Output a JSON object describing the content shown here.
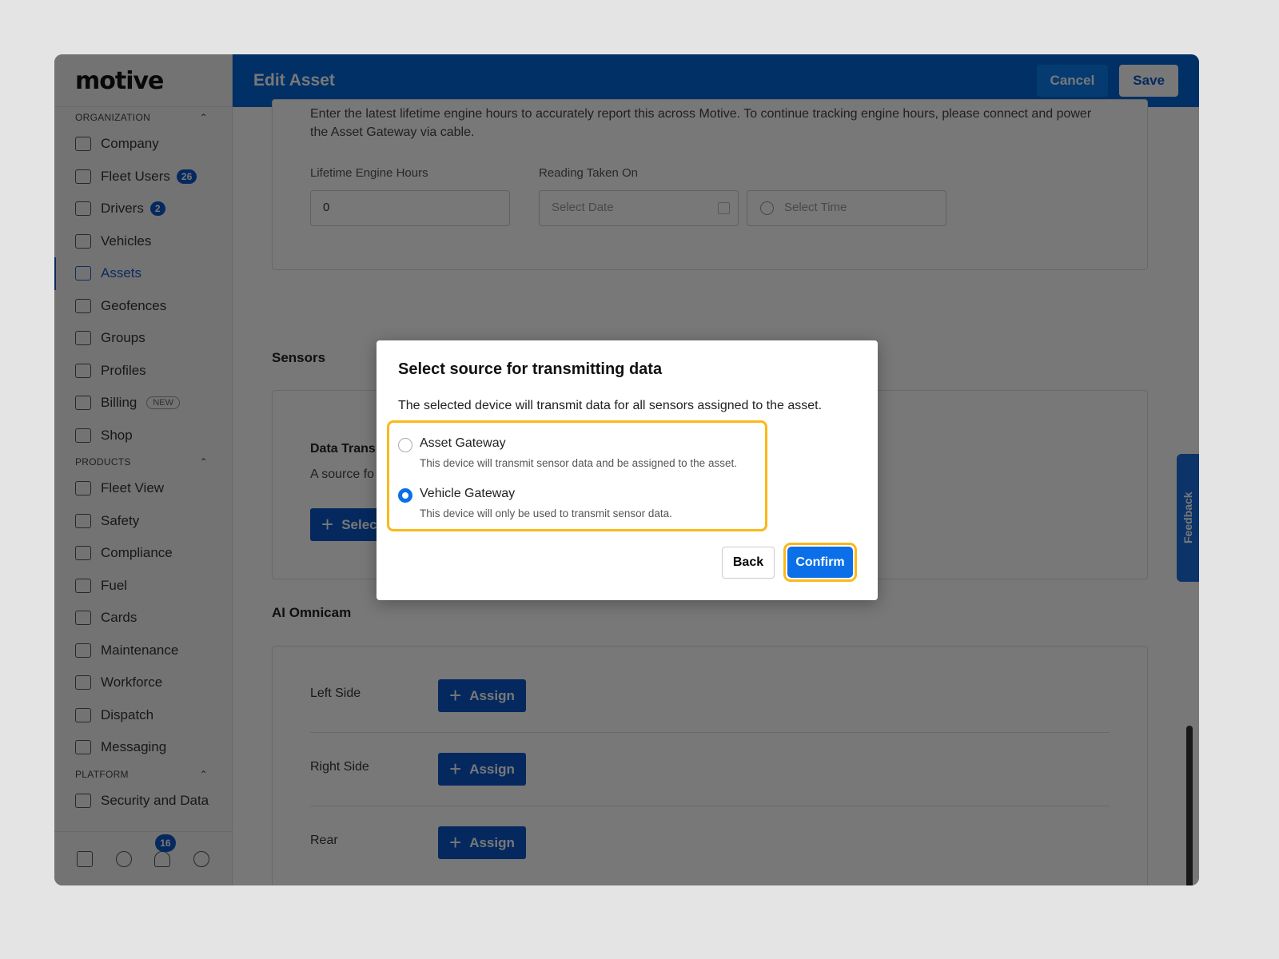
{
  "app": {
    "logo": "motive",
    "title": "Edit Asset",
    "cancel": "Cancel",
    "save": "Save",
    "feedback": "Feedback"
  },
  "sidebar": {
    "sections": [
      {
        "label": "ORGANIZATION",
        "items": [
          {
            "label": "Company"
          },
          {
            "label": "Fleet Users",
            "badge": "26"
          },
          {
            "label": "Drivers",
            "badge": "2"
          },
          {
            "label": "Vehicles"
          },
          {
            "label": "Assets",
            "active": true
          },
          {
            "label": "Geofences"
          },
          {
            "label": "Groups"
          },
          {
            "label": "Profiles"
          },
          {
            "label": "Billing",
            "tag": "NEW"
          },
          {
            "label": "Shop"
          }
        ]
      },
      {
        "label": "PRODUCTS",
        "items": [
          {
            "label": "Fleet View"
          },
          {
            "label": "Safety"
          },
          {
            "label": "Compliance"
          },
          {
            "label": "Fuel"
          },
          {
            "label": "Cards"
          },
          {
            "label": "Maintenance"
          },
          {
            "label": "Workforce"
          },
          {
            "label": "Dispatch"
          },
          {
            "label": "Messaging"
          }
        ]
      },
      {
        "label": "PLATFORM",
        "items": [
          {
            "label": "Security and Data"
          }
        ]
      }
    ],
    "notifications": "16"
  },
  "engine": {
    "text": "Enter the latest lifetime engine hours to accurately report this across Motive. To continue tracking engine hours, please connect and power the Asset Gateway via cable.",
    "hours_label": "Lifetime Engine Hours",
    "hours_value": "0",
    "reading_label": "Reading Taken On",
    "date_placeholder": "Select Date",
    "time_placeholder": "Select Time"
  },
  "sensors": {
    "heading": "Sensors",
    "sub_title": "Data Trans",
    "sub_text": "A source fo",
    "select_btn": "Selec"
  },
  "omnicam": {
    "heading": "AI Omnicam",
    "rows": [
      {
        "name": "Left Side",
        "btn": "Assign"
      },
      {
        "name": "Right Side",
        "btn": "Assign"
      },
      {
        "name": "Rear",
        "btn": "Assign"
      }
    ]
  },
  "dialog": {
    "title": "Select source for transmitting data",
    "desc": "The selected device will transmit data for all sensors assigned to the asset.",
    "options": [
      {
        "title": "Asset Gateway",
        "sub": "This device will transmit sensor data and be assigned to the asset.",
        "selected": false
      },
      {
        "title": "Vehicle Gateway",
        "sub": "This device will only be used to transmit sensor data.",
        "selected": true
      }
    ],
    "back": "Back",
    "confirm": "Confirm"
  },
  "colors": {
    "brand": "#0066d9",
    "accent": "#0a6fe8",
    "highlight": "#fbb818"
  }
}
